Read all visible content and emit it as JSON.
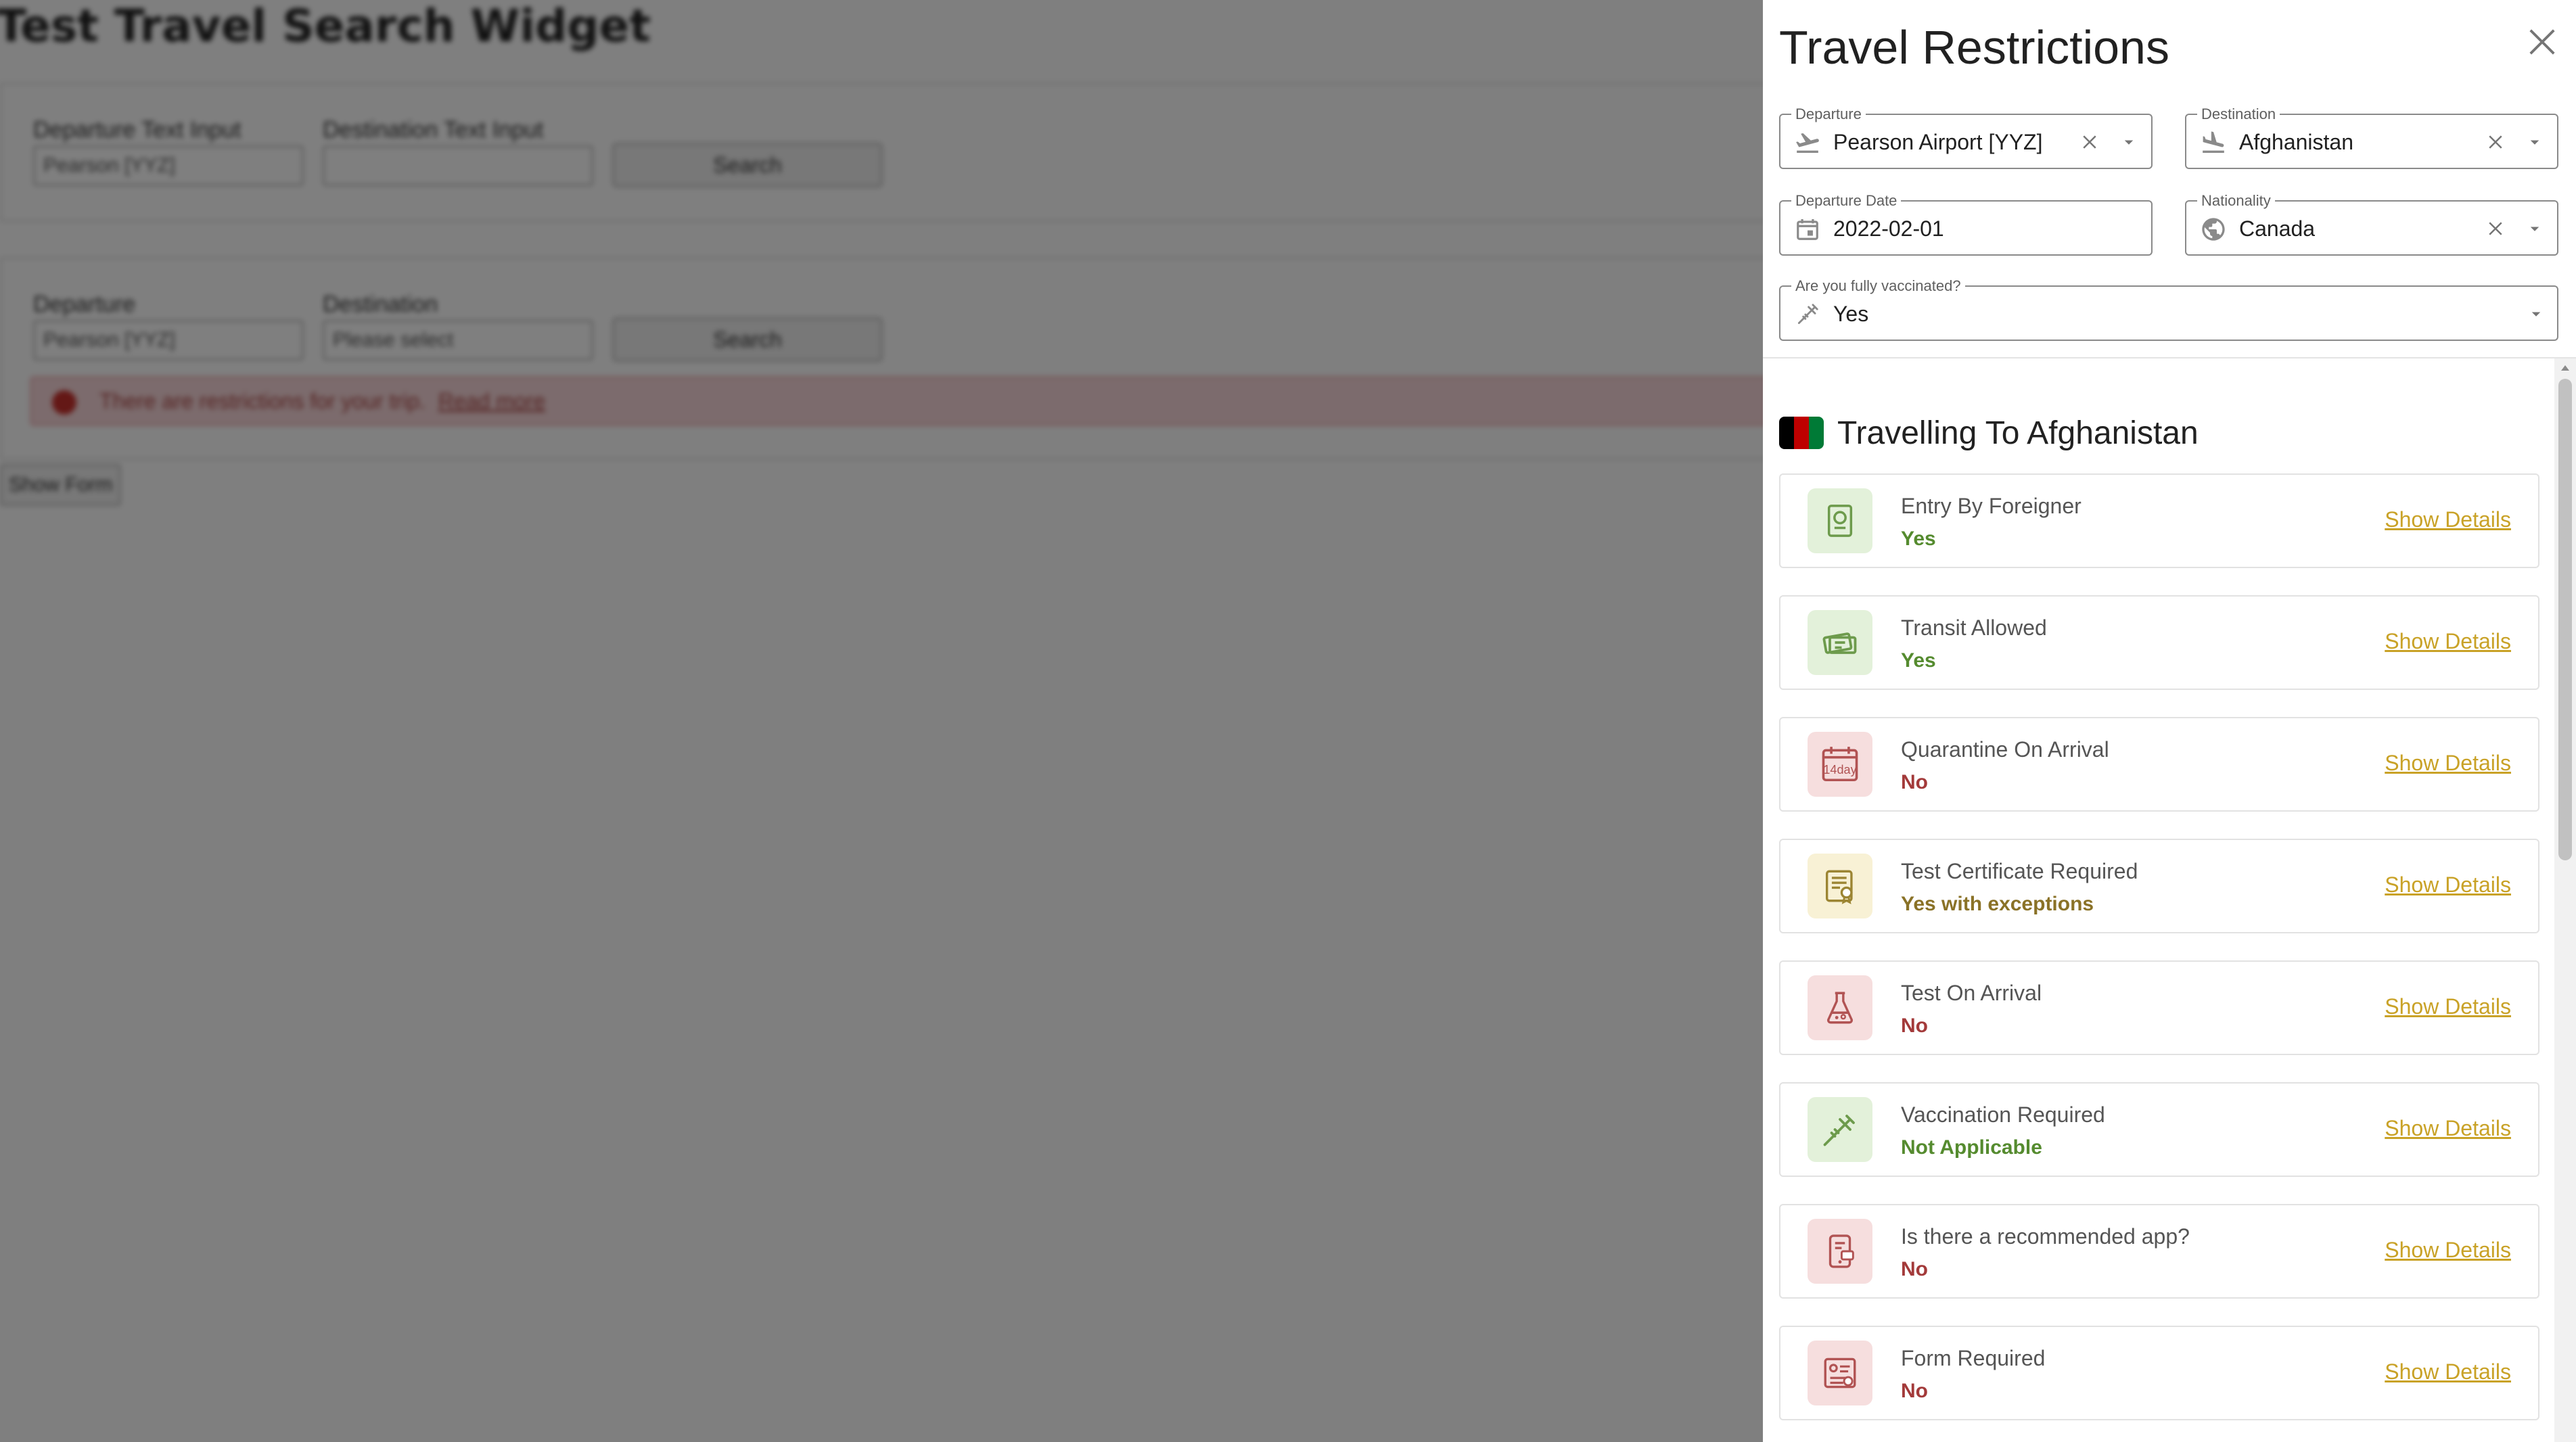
{
  "background": {
    "title": "Test Travel Search Widget",
    "form1": {
      "departure_label": "Departure Text Input",
      "departure_value": "Pearson [YYZ]",
      "destination_label": "Destination Text Input",
      "destination_value": "",
      "search_label": "Search"
    },
    "form2": {
      "departure_label": "Departure",
      "departure_value": "Pearson [YYZ]",
      "destination_label": "Destination",
      "destination_value": "Please select",
      "search_label": "Search"
    },
    "alert": {
      "text": "There are restrictions for your trip.",
      "link": "Read more"
    },
    "show_form_label": "Show Form"
  },
  "drawer": {
    "title": "Travel Restrictions",
    "close_icon": "close-icon",
    "form": {
      "departure": {
        "label": "Departure",
        "value": "Pearson Airport [YYZ]",
        "icon": "flight-takeoff-icon"
      },
      "destination": {
        "label": "Destination",
        "value": "Afghanistan",
        "icon": "flight-land-icon"
      },
      "departure_date": {
        "label": "Departure Date",
        "value": "2022-02-01",
        "icon": "calendar-icon"
      },
      "nationality": {
        "label": "Nationality",
        "value": "Canada",
        "icon": "globe-icon"
      },
      "vaccinated": {
        "label": "Are you fully vaccinated?",
        "value": "Yes",
        "icon": "syringe-icon"
      }
    },
    "section": {
      "title": "Travelling To Afghanistan",
      "flag_colors": [
        "#000000",
        "#be0000",
        "#007a36"
      ]
    },
    "cards": [
      {
        "name": "Entry By Foreigner",
        "status": "Yes",
        "tone": "green",
        "icon": "passport-icon",
        "link": "Show Details"
      },
      {
        "name": "Transit Allowed",
        "status": "Yes",
        "tone": "green",
        "icon": "tickets-icon",
        "link": "Show Details"
      },
      {
        "name": "Quarantine On Arrival",
        "status": "No",
        "tone": "red",
        "icon": "calendar-14-day-icon",
        "icon_text": "14day",
        "link": "Show Details"
      },
      {
        "name": "Test Certificate Required",
        "status": "Yes with exceptions",
        "tone": "amber",
        "icon": "certificate-icon",
        "link": "Show Details"
      },
      {
        "name": "Test On Arrival",
        "status": "No",
        "tone": "red",
        "icon": "test-flask-icon",
        "link": "Show Details"
      },
      {
        "name": "Vaccination Required",
        "status": "Not Applicable",
        "tone": "green",
        "icon": "syringe-icon",
        "link": "Show Details"
      },
      {
        "name": "Is there a recommended app?",
        "status": "No",
        "tone": "red",
        "icon": "phone-app-icon",
        "link": "Show Details"
      },
      {
        "name": "Form Required",
        "status": "No",
        "tone": "red",
        "icon": "form-icon",
        "link": "Show Details"
      }
    ],
    "colors": {
      "green": "#558b2f",
      "green_bg": "#e3f1da",
      "green_icon": "#6d9b4c",
      "red": "#a33a3a",
      "red_bg": "#f6dede",
      "red_icon": "#b15353",
      "amber": "#8a7227",
      "amber_bg": "#f8f1d5",
      "amber_icon": "#9c8533",
      "link": "#c9a227"
    }
  }
}
